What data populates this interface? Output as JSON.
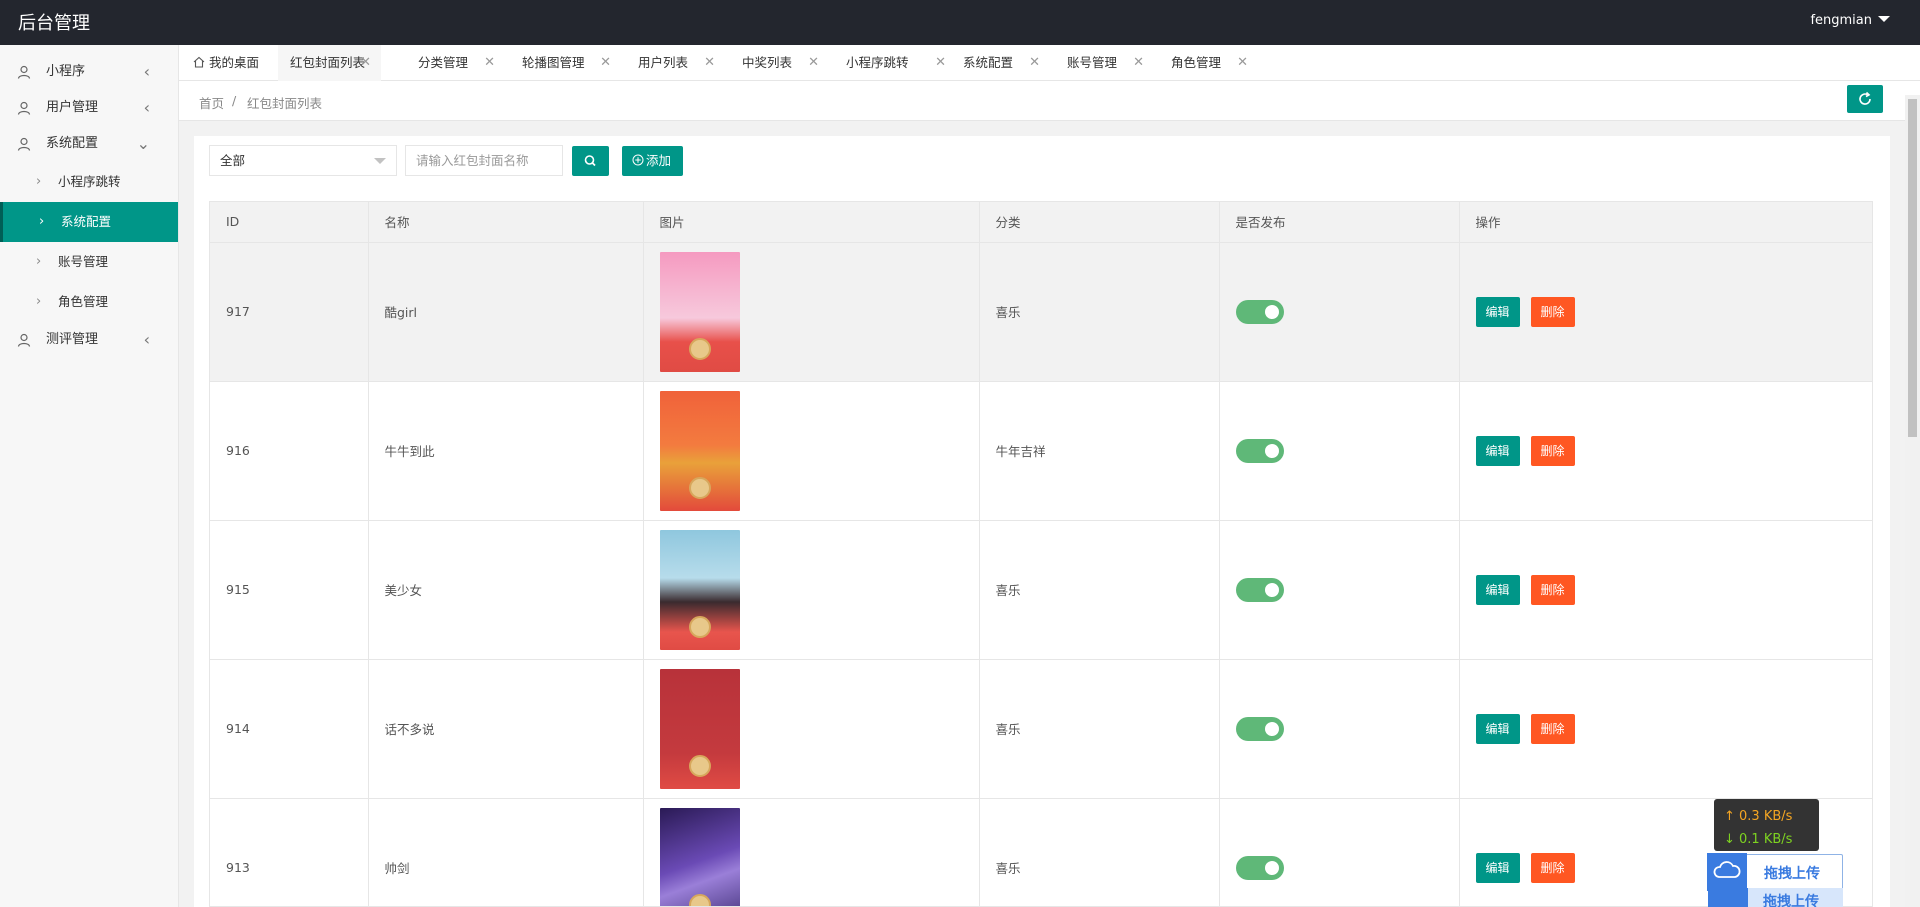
{
  "header": {
    "title": "后台管理",
    "user": "fengmian"
  },
  "sidebar": {
    "items": [
      {
        "label": "小程序",
        "arrow": "‹"
      },
      {
        "label": "用户管理",
        "arrow": "‹"
      },
      {
        "label": "系统配置",
        "arrow": "⌄"
      }
    ],
    "sub_items": [
      {
        "label": "小程序跳转"
      },
      {
        "label": "系统配置"
      },
      {
        "label": "账号管理"
      },
      {
        "label": "角色管理"
      }
    ],
    "last_item": {
      "label": "测评管理",
      "arrow": "‹"
    }
  },
  "tabs": [
    {
      "label": "我的桌面"
    },
    {
      "label": "红包封面列表"
    },
    {
      "label": "分类管理"
    },
    {
      "label": "轮播图管理"
    },
    {
      "label": "用户列表"
    },
    {
      "label": "中奖列表"
    },
    {
      "label": "小程序跳转"
    },
    {
      "label": "系统配置"
    },
    {
      "label": "账号管理"
    },
    {
      "label": "角色管理"
    }
  ],
  "breadcrumb": {
    "home": "首页",
    "sep": "/",
    "current": "红包封面列表"
  },
  "filter": {
    "select_value": "全部",
    "search_placeholder": "请输入红包封面名称",
    "add_label": "添加"
  },
  "table": {
    "headers": [
      "ID",
      "名称",
      "图片",
      "分类",
      "是否发布",
      "操作"
    ],
    "rows": [
      {
        "id": "917",
        "name": "酷girl",
        "category": "喜乐",
        "published": true
      },
      {
        "id": "916",
        "name": "牛牛到此",
        "category": "牛年吉祥",
        "published": true
      },
      {
        "id": "915",
        "name": "美少女",
        "category": "喜乐",
        "published": true
      },
      {
        "id": "914",
        "name": "话不多说",
        "category": "喜乐",
        "published": true
      },
      {
        "id": "913",
        "name": "帅剑",
        "category": "喜乐",
        "published": true
      }
    ],
    "edit_label": "编辑",
    "delete_label": "删除"
  },
  "speed": {
    "up": "↑ 0.3 KB/s",
    "down": "↓ 0.1 KB/s"
  },
  "upload": {
    "label": "拖拽上传",
    "label2": "拖拽上传"
  },
  "colors": {
    "primary": "#009688",
    "danger": "#ff5722",
    "header_bg": "#23262e",
    "toggle_on": "#5fb878"
  }
}
